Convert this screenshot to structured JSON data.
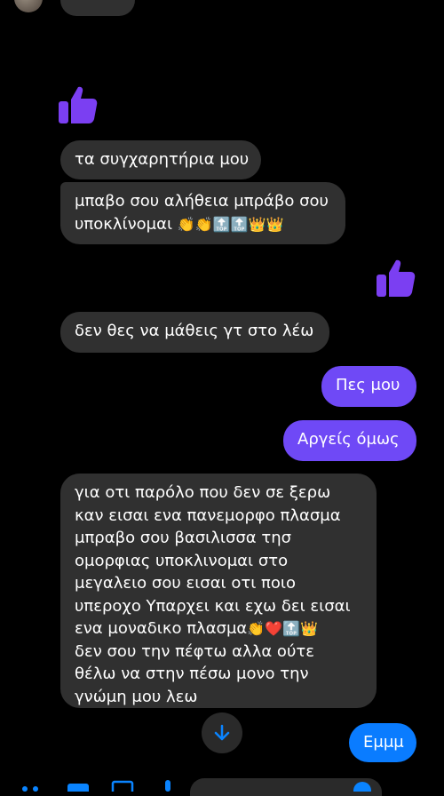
{
  "messages": {
    "m1": "τα συγχαρητήρια μου",
    "m2_line1": "μπαβο σου αλήθεια μπράβο σου",
    "m2_line2": "υποκλίνομαι",
    "m2_emojis": "👏👏🔝🔝👑👑",
    "m3": "δεν θες να μάθεις γτ στο λέω",
    "m4": "Πες μου",
    "m5": "Αργείς όμως",
    "m6_lines": [
      "για οτι παρόλο που δεν σε ξερω",
      "καν εισαι ενα πανεμορφο πλασμα",
      "μπραβο σου βασιλισσα τησ",
      "ομορφιας υποκλινομαι στο",
      "μεγαλειο σου εισαι οτι ποιο",
      "υπεροχο Υπαρχει και εχω δει εισαι",
      "ενα μοναδικο πλασμα",
      "δεν σου την πέφτω αλλα ούτε",
      "θέλω να στην πέσω μονο την",
      "γνώμη μου λεω"
    ],
    "m6_emojis": "👏❤️🔝👑",
    "m7": "Εμμμ"
  },
  "icons": {
    "thumb_icon": "thumbs-up",
    "scroll_icon": "arrow-down"
  },
  "colors": {
    "incoming": "#303030",
    "outgoing_purple": "#6f49f6",
    "outgoing_blue": "#0a7cff",
    "thumb": "#7b3ff2"
  }
}
